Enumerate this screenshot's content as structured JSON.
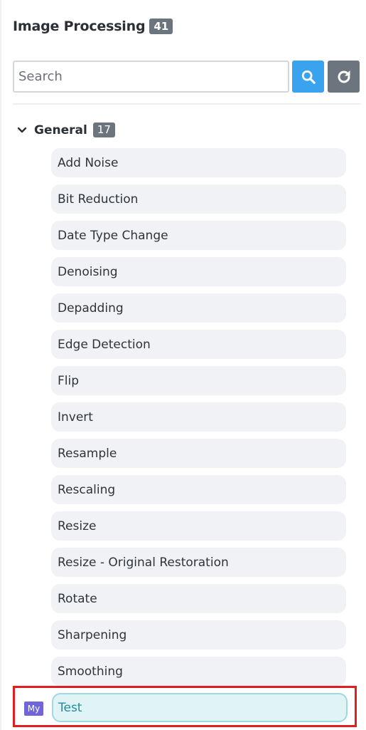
{
  "panel": {
    "title": "Image Processing",
    "count": "41"
  },
  "search": {
    "placeholder": "Search",
    "value": ""
  },
  "icons": {
    "search_button": "search-icon",
    "refresh_button": "refresh-icon",
    "group_toggle": "chevron-down-icon"
  },
  "colors": {
    "search_button": "#3aa3f0",
    "refresh_button": "#6c757d",
    "highlight_border": "#e01e22",
    "my_badge": "#6f64d8",
    "selected_item_bg": "#e0f3f5"
  },
  "group": {
    "label": "General",
    "count": "17",
    "items": [
      {
        "label": "Add Noise"
      },
      {
        "label": "Bit Reduction"
      },
      {
        "label": "Date Type Change"
      },
      {
        "label": "Denoising"
      },
      {
        "label": "Depadding"
      },
      {
        "label": "Edge Detection"
      },
      {
        "label": "Flip"
      },
      {
        "label": "Invert"
      },
      {
        "label": "Resample"
      },
      {
        "label": "Rescaling"
      },
      {
        "label": "Resize"
      },
      {
        "label": "Resize - Original Restoration"
      },
      {
        "label": "Rotate"
      },
      {
        "label": "Sharpening"
      },
      {
        "label": "Smoothing"
      }
    ]
  },
  "custom": {
    "badge": "My",
    "item_label": "Test"
  }
}
